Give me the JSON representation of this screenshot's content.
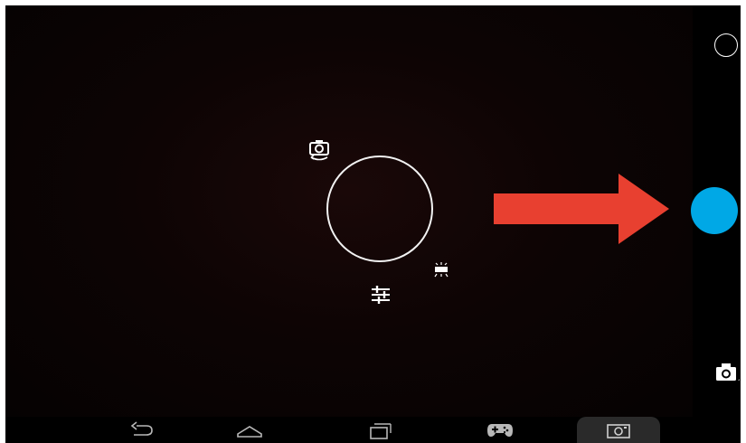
{
  "screen": {
    "mode": "camera-preview",
    "accent_color": "#00a8e6",
    "arrow_color": "#e84030"
  },
  "viewfinder_controls": {
    "switch_camera_icon": "camera-switch-icon",
    "settings_icon": "sliders-icon",
    "flash_icon": "flash-icon",
    "focus_ring": "pie-menu-ring"
  },
  "side_panel": {
    "mode_toggle_icon": "circle-outline-icon",
    "shutter_icon": "shutter-button",
    "camera_mode_icon": "camera-icon"
  },
  "navbar": {
    "items": [
      "back-icon",
      "home-icon",
      "recent-apps-icon",
      "gamepad-icon",
      "screenshot-icon"
    ],
    "active_item": "screenshot-icon"
  }
}
